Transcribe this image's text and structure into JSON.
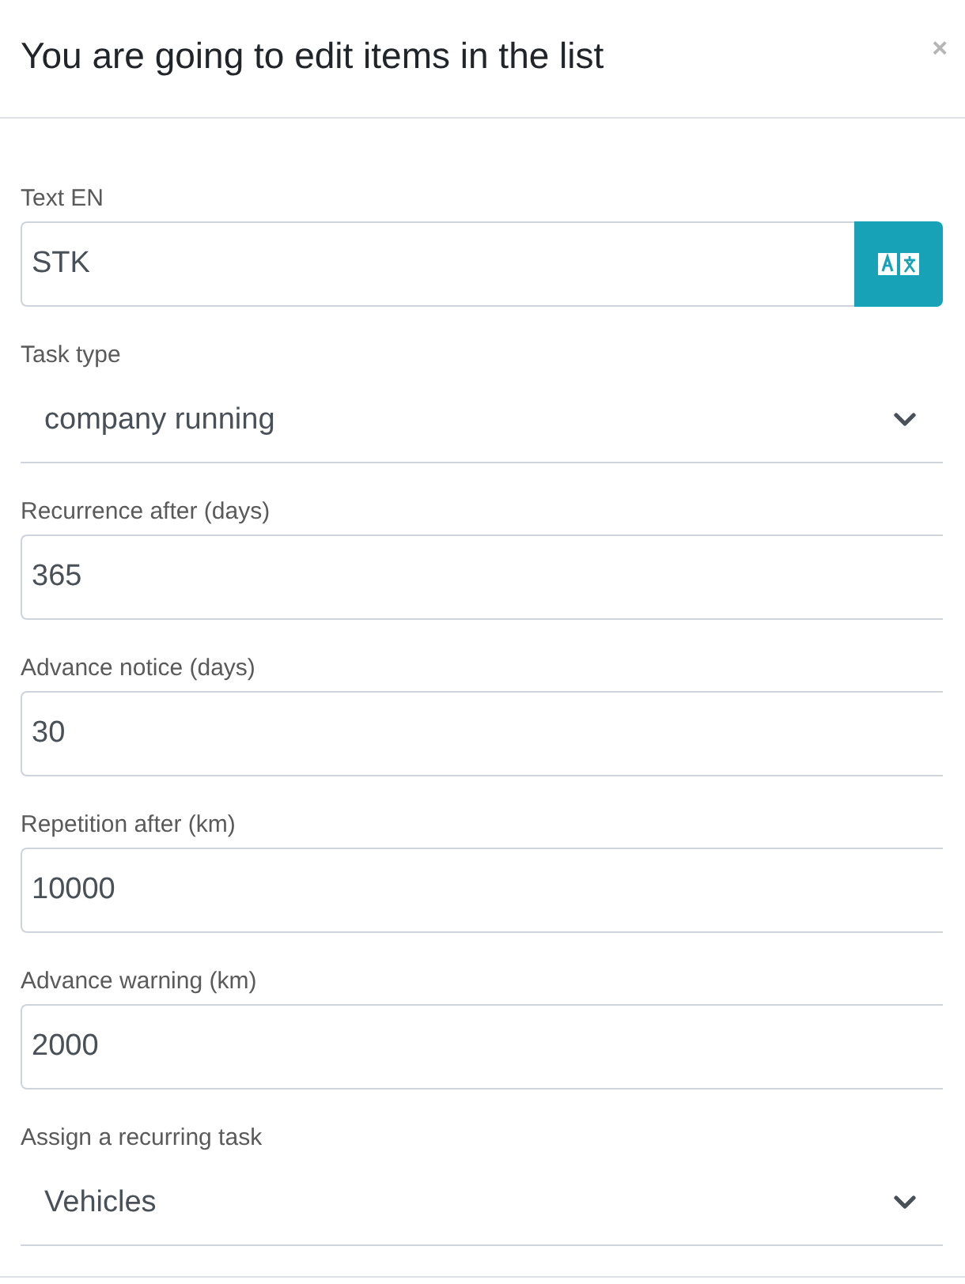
{
  "dialog": {
    "title": "You are going to edit items in the list",
    "close": "×"
  },
  "fields": [
    {
      "kind": "text-translate",
      "label": "Text EN",
      "value": "STK"
    },
    {
      "kind": "select",
      "label": "Task type",
      "value": "company running"
    },
    {
      "kind": "text",
      "label": "Recurrence after (days)",
      "value": "365"
    },
    {
      "kind": "text",
      "label": "Advance notice (days)",
      "value": "30"
    },
    {
      "kind": "text",
      "label": "Repetition after (km)",
      "value": "10000"
    },
    {
      "kind": "text",
      "label": "Advance warning (km)",
      "value": "2000"
    },
    {
      "kind": "select",
      "label": "Assign a recurring task",
      "value": "Vehicles"
    }
  ]
}
